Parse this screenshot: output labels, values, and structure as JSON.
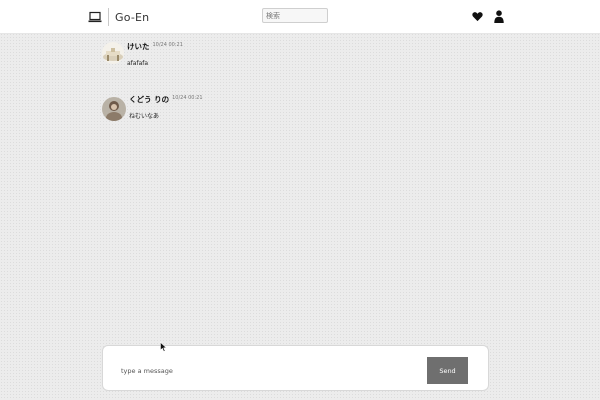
{
  "header": {
    "app_name": "Go-En",
    "search_placeholder": "検索"
  },
  "messages": [
    {
      "user": "けいた",
      "time": "10/24 00:21",
      "text": "afafafa"
    },
    {
      "user": "くどう りの",
      "time": "10/24 00:21",
      "text": "ねむいなあ"
    }
  ],
  "composer": {
    "placeholder": "type a message",
    "send_label": "Send"
  },
  "colors": {
    "send_button": "#6f6f6f",
    "background": "#ececec"
  },
  "icons": {
    "brand": "laptop-icon",
    "favorites": "heart-icon",
    "account": "user-icon"
  }
}
